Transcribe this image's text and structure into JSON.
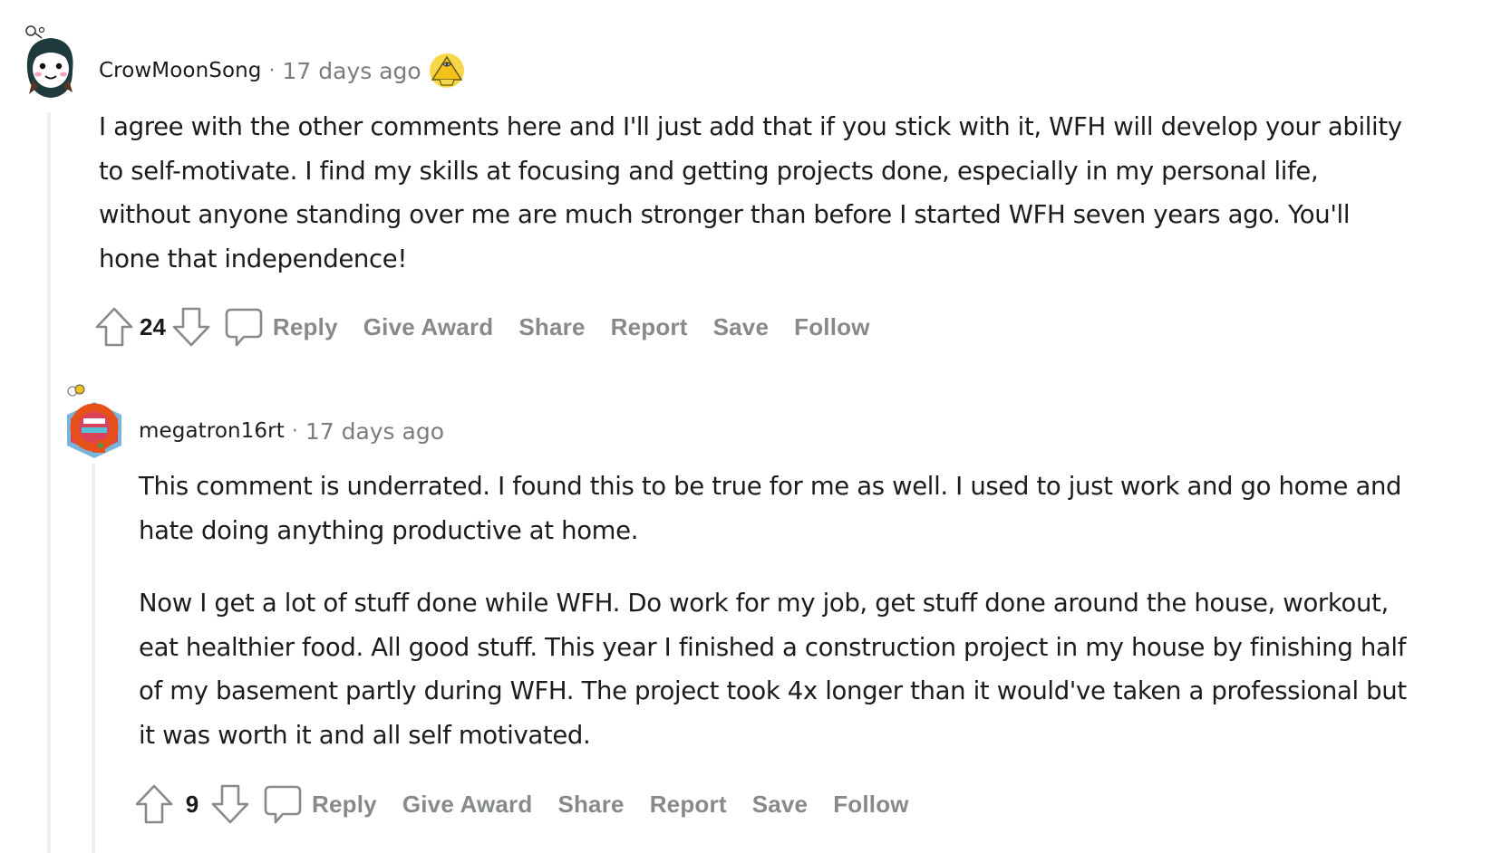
{
  "comments": [
    {
      "username": "CrowMoonSong",
      "separator": "·",
      "time": "17 days ago",
      "has_award": true,
      "award_icon": "pyramid-award-icon",
      "paragraphs": [
        "I agree with the other comments here and I'll just add that if you stick with it, WFH will develop your ability to self-motivate. I find my skills at focusing and getting projects done, especially in my personal life, without anyone standing over me are much stronger than before I started WFH seven years ago. You'll hone that independence!"
      ],
      "score": "24",
      "actions": {
        "reply": "Reply",
        "give_award": "Give Award",
        "share": "Share",
        "report": "Report",
        "save": "Save",
        "follow": "Follow"
      },
      "colors": {
        "avatar_hood": "#1f3a3d",
        "action_text": "#878a8c"
      }
    },
    {
      "username": "megatron16rt",
      "separator": "·",
      "time": "17 days ago",
      "has_award": false,
      "paragraphs": [
        "This comment is underrated. I found this to be true for me as well. I used to just work and go home and hate doing anything productive at home.",
        "Now I get a lot of stuff done while WFH. Do work for my job, get stuff done around the house, workout, eat healthier food. All good stuff. This year I finished a construction project in my house by finishing half of my basement partly during WFH. The project took 4x longer than it would've taken a professional but it was worth it and all self motivated."
      ],
      "score": "9",
      "actions": {
        "reply": "Reply",
        "give_award": "Give Award",
        "share": "Share",
        "report": "Report",
        "save": "Save",
        "follow": "Follow"
      },
      "colors": {
        "avatar_primary": "#e8501a",
        "action_text": "#878a8c"
      }
    }
  ]
}
